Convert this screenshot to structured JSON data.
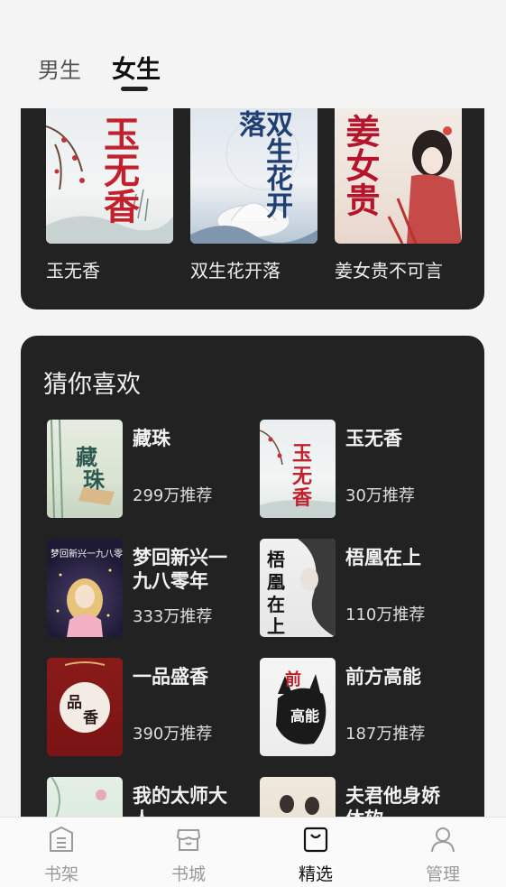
{
  "tabs": [
    {
      "label": "男生",
      "active": false
    },
    {
      "label": "女生",
      "active": true
    }
  ],
  "top_books": [
    {
      "title": "玉无香",
      "cover_chars": "玉无香"
    },
    {
      "title": "双生花开落",
      "cover_chars": "双生花开落"
    },
    {
      "title": "姜女贵不可言",
      "cover_chars": "姜女贵"
    }
  ],
  "recommend": {
    "title": "猜你喜欢",
    "items": [
      {
        "name": "藏珠",
        "count": "299万推荐"
      },
      {
        "name": "玉无香",
        "count": "30万推荐"
      },
      {
        "name": "梦回新兴一九八零年",
        "count": "333万推荐"
      },
      {
        "name": "梧凰在上",
        "count": "110万推荐"
      },
      {
        "name": "一品盛香",
        "count": "390万推荐"
      },
      {
        "name": "前方高能",
        "count": "187万推荐"
      },
      {
        "name": "我的太师大人",
        "count": ""
      },
      {
        "name": "夫君他身娇体软",
        "count": ""
      }
    ]
  },
  "bottom_nav": [
    {
      "label": "书架",
      "icon": "bookshelf-icon",
      "active": false
    },
    {
      "label": "书城",
      "icon": "bookstore-icon",
      "active": false
    },
    {
      "label": "精选",
      "icon": "featured-bag-icon",
      "active": true
    },
    {
      "label": "管理",
      "icon": "user-icon",
      "active": false
    }
  ],
  "colors": {
    "background": "#f4f4f5",
    "card": "#222223",
    "nav_active": "#111111",
    "nav_inactive": "#9a9a9a"
  }
}
